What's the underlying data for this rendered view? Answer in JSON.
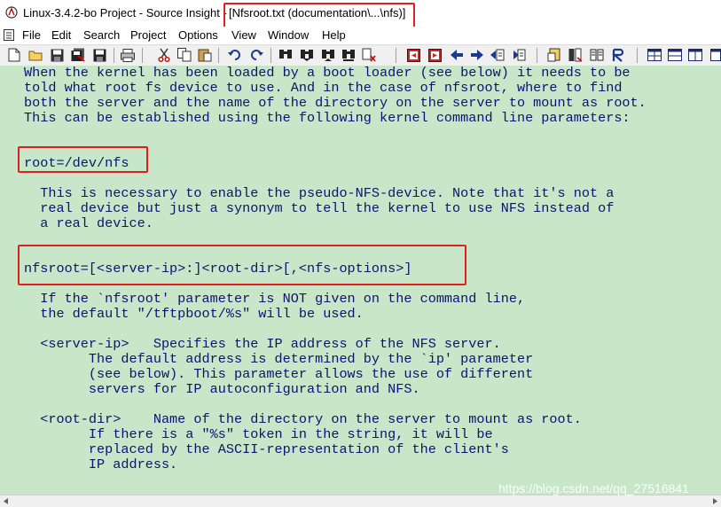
{
  "window": {
    "app_title": "Linux-3.4.2-bo Project - Source Insight -",
    "doc_title": "[Nfsroot.txt (documentation\\...\\nfs)]"
  },
  "menu": [
    "File",
    "Edit",
    "Search",
    "Project",
    "Options",
    "View",
    "Window",
    "Help"
  ],
  "toolbar": {
    "buttons": [
      "new-file-icon",
      "open-folder-icon",
      "save-icon",
      "save-all-icon",
      "close-file-icon",
      "print-icon",
      "cut-icon",
      "copy-icon",
      "paste-icon",
      "undo-icon",
      "redo-icon",
      "find-icon",
      "find-prev-icon",
      "find-next-icon",
      "find-references-icon",
      "replace-icon",
      "bookmark-prev-icon",
      "bookmark-next-icon",
      "go-back-icon",
      "go-forward-icon",
      "jump-prev-icon",
      "jump-next-icon",
      "symbol-info-icon",
      "project-icon",
      "browse-icon",
      "relation-icon",
      "window-tile-icon",
      "window-layout-icon",
      "window-list-icon",
      "window-cascade-icon"
    ]
  },
  "document": {
    "lines": [
      "When the kernel has been loaded by a boot loader (see below) it needs to be",
      "told what root fs device to use. And in the case of nfsroot, where to find",
      "both the server and the name of the directory on the server to mount as root.",
      "This can be established using the following kernel command line parameters:",
      "",
      "",
      "root=/dev/nfs",
      "",
      "",
      "  This is necessary to enable the pseudo-NFS-device. Note that it's not a",
      "  real device but just a synonym to tell the kernel to use NFS instead of",
      "  a real device.",
      "",
      "",
      "nfsroot=[<server-ip>:]<root-dir>[,<nfs-options>]",
      "",
      "  If the `nfsroot' parameter is NOT given on the command line,",
      "  the default \"/tftpboot/%s\" will be used.",
      "",
      "  <server-ip>   Specifies the IP address of the NFS server.",
      "        The default address is determined by the `ip' parameter",
      "        (see below). This parameter allows the use of different",
      "        servers for IP autoconfiguration and NFS.",
      "",
      "  <root-dir>    Name of the directory on the server to mount as root.",
      "        If there is a \"%s\" token in the string, it will be",
      "        replaced by the ASCII-representation of the client's",
      "        IP address."
    ]
  },
  "watermark": "https://blog.csdn.net/qq_27516841",
  "colors": {
    "editor_bg": "#c8e6c8",
    "text": "#0a1470",
    "highlight": "#e0201e"
  }
}
